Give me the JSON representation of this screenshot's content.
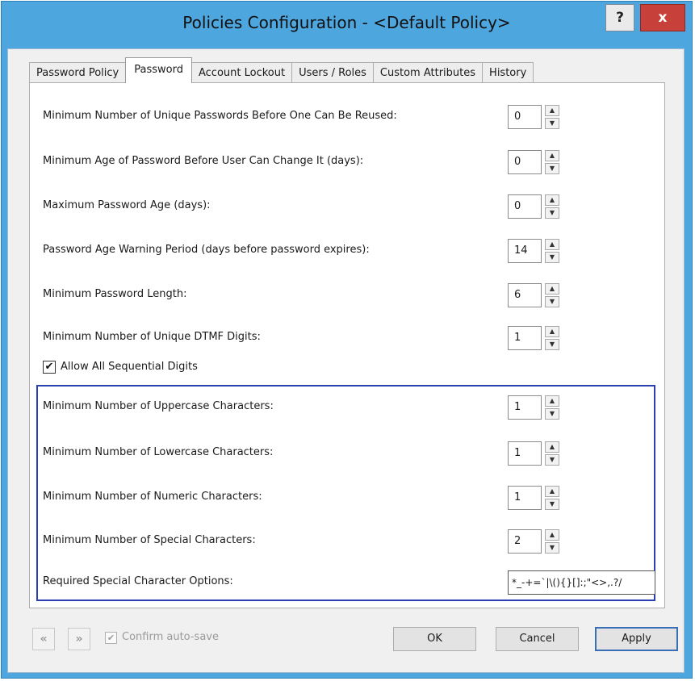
{
  "window": {
    "title": "Policies Configuration - <Default Policy>",
    "help_glyph": "?",
    "close_glyph": "x"
  },
  "tabs": [
    {
      "label": "Password Policy",
      "active": false
    },
    {
      "label": "Password",
      "active": true
    },
    {
      "label": "Account Lockout",
      "active": false
    },
    {
      "label": "Users / Roles",
      "active": false
    },
    {
      "label": "Custom Attributes",
      "active": false
    },
    {
      "label": "History",
      "active": false
    }
  ],
  "settings": [
    {
      "label": "Minimum Number of Unique Passwords Before One Can Be Reused:",
      "value": "0"
    },
    {
      "label": "Minimum Age of Password Before User Can Change It (days):",
      "value": "0"
    },
    {
      "label": "Maximum Password Age (days):",
      "value": "0"
    },
    {
      "label": "Password Age Warning Period (days before password expires):",
      "value": "14"
    },
    {
      "label": "Minimum Password Length:",
      "value": "6"
    },
    {
      "label": "Minimum Number of Unique DTMF Digits:",
      "value": "1"
    }
  ],
  "allow_sequential": {
    "label": "Allow All Sequential Digits",
    "checked": true,
    "mark": "✔"
  },
  "complexity": [
    {
      "label": "Minimum Number of Uppercase Characters:",
      "value": "1"
    },
    {
      "label": "Minimum Number of Lowercase Characters:",
      "value": "1"
    },
    {
      "label": "Minimum Number of Numeric Characters:",
      "value": "1"
    },
    {
      "label": "Minimum Number of Special Characters:",
      "value": "2"
    }
  ],
  "special_options": {
    "label": "Required Special Character Options:",
    "value": "*_-+=`|\\(){}[]:;\"<>,.?/"
  },
  "footer": {
    "prev_glyph": "«",
    "next_glyph": "»",
    "confirm_label": "Confirm auto-save",
    "confirm_checked": true,
    "confirm_mark": "✔",
    "ok_label": "OK",
    "cancel_label": "Cancel",
    "apply_label": "Apply"
  },
  "colors": {
    "title_bar": "#4ea6de",
    "close_button": "#c7403a",
    "group_border": "#2a3fb2"
  }
}
